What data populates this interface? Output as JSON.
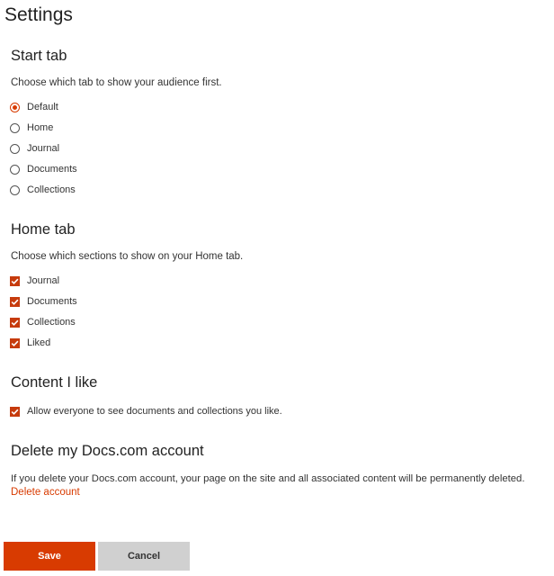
{
  "page": {
    "title": "Settings"
  },
  "start_tab": {
    "heading": "Start tab",
    "description": "Choose which tab to show your audience first.",
    "selected": "Default",
    "options": [
      {
        "label": "Default",
        "checked": true
      },
      {
        "label": "Home",
        "checked": false
      },
      {
        "label": "Journal",
        "checked": false
      },
      {
        "label": "Documents",
        "checked": false
      },
      {
        "label": "Collections",
        "checked": false
      }
    ]
  },
  "home_tab": {
    "heading": "Home tab",
    "description": "Choose which sections to show on your Home tab.",
    "options": [
      {
        "label": "Journal",
        "checked": true
      },
      {
        "label": "Documents",
        "checked": true
      },
      {
        "label": "Collections",
        "checked": true
      },
      {
        "label": "Liked",
        "checked": true
      }
    ]
  },
  "content_like": {
    "heading": "Content I like",
    "option": {
      "label": "Allow everyone to see documents and collections you like.",
      "checked": true
    }
  },
  "delete_account": {
    "heading": "Delete my Docs.com account",
    "description": "If you delete your Docs.com account, your page on the site and all associated content will be permanently deleted.",
    "link_label": "Delete account"
  },
  "actions": {
    "save_label": "Save",
    "cancel_label": "Cancel"
  },
  "colors": {
    "accent": "#d83b01",
    "checkbox": "#c63b0d",
    "cancel_bg": "#d0d0d0"
  },
  "icons": {
    "checkmark": "checkmark-icon"
  }
}
